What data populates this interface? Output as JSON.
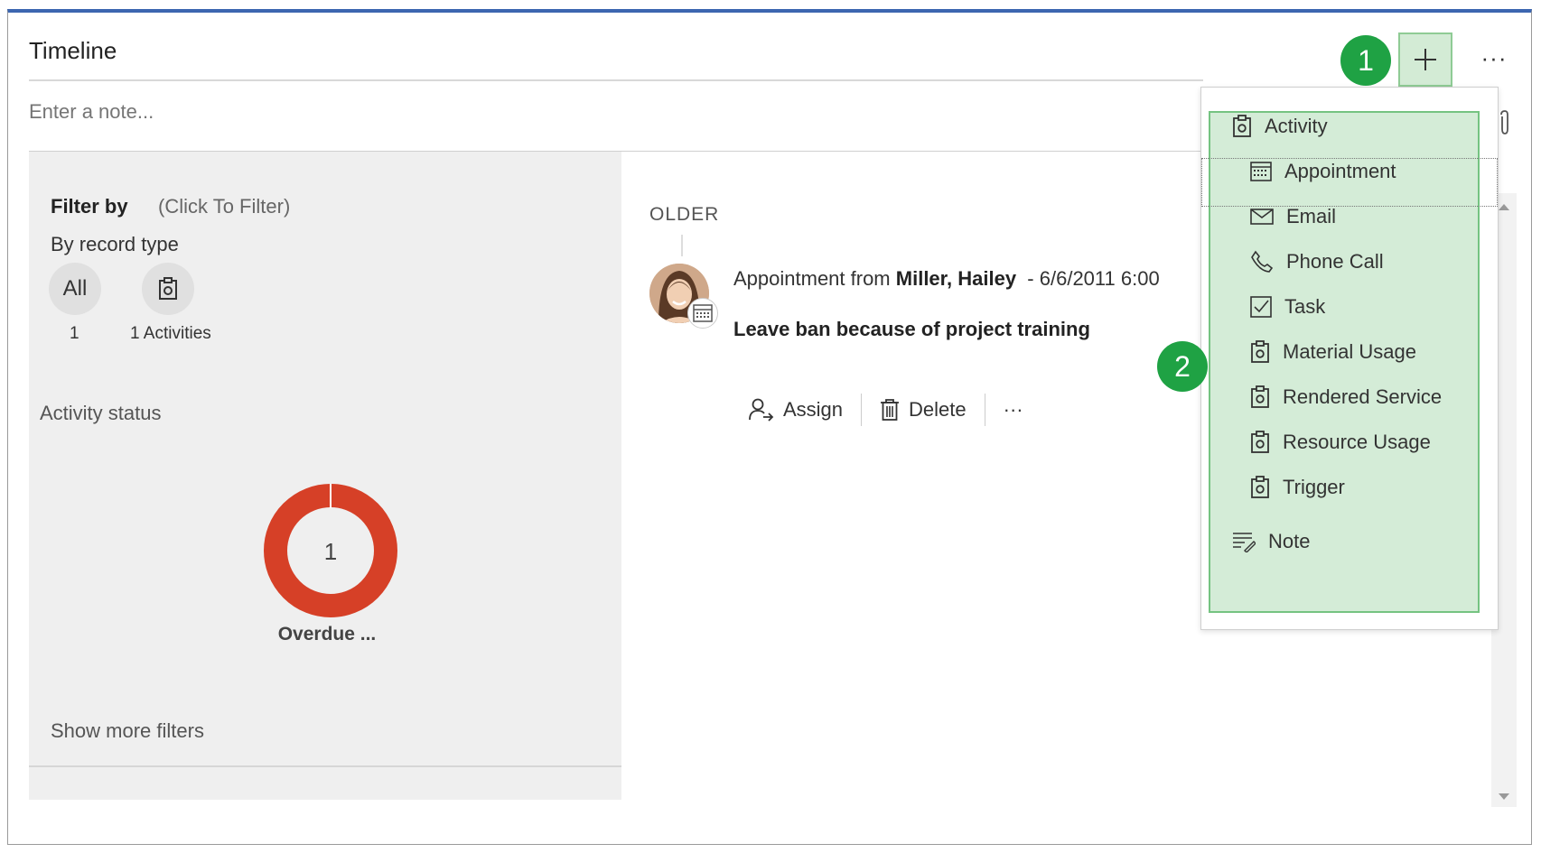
{
  "timeline": {
    "title": "Timeline",
    "note_placeholder": "Enter a note...",
    "more_label": "···"
  },
  "filter": {
    "title": "Filter by",
    "hint": "(Click To Filter)",
    "by_record_type": "By record type",
    "all_label": "All",
    "all_count": "1",
    "activities_count": "1 Activities",
    "activity_status": "Activity status",
    "donut_value": "1",
    "donut_label": "Overdue ...",
    "donut_color": "#d64027",
    "show_more": "Show more filters"
  },
  "feed": {
    "section": "OLDER",
    "item": {
      "title_prefix": "Appointment from",
      "author": "Miller, Hailey",
      "separator": "-",
      "date": "6/6/2011 6:00",
      "subject": "Leave ban because of project training",
      "actions": {
        "assign": "Assign",
        "delete": "Delete",
        "more": "···"
      }
    }
  },
  "menu": {
    "items": [
      {
        "label": "Activity",
        "icon": "clipboard-gear-icon"
      },
      {
        "label": "Appointment",
        "icon": "calendar-icon"
      },
      {
        "label": "Email",
        "icon": "envelope-icon"
      },
      {
        "label": "Phone Call",
        "icon": "phone-icon"
      },
      {
        "label": "Task",
        "icon": "checkbox-icon"
      },
      {
        "label": "Material Usage",
        "icon": "clipboard-gear-icon"
      },
      {
        "label": "Rendered Service",
        "icon": "clipboard-gear-icon"
      },
      {
        "label": "Resource Usage",
        "icon": "clipboard-gear-icon"
      },
      {
        "label": "Trigger",
        "icon": "clipboard-gear-icon"
      },
      {
        "label": "Note",
        "icon": "note-lines-icon"
      }
    ]
  },
  "callouts": {
    "one": "1",
    "two": "2",
    "color": "#1fa244"
  }
}
